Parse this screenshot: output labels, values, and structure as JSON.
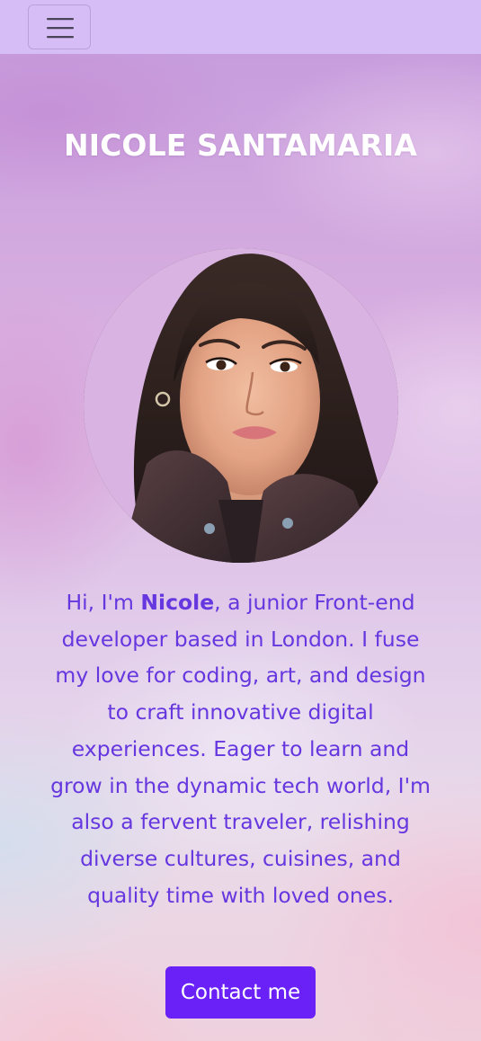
{
  "navbar": {
    "toggle_icon": "hamburger-menu-icon",
    "background_color": "#d7bdf5"
  },
  "hero": {
    "title": "NICOLE SANTAMARIA",
    "portrait_subject": "profile-photo",
    "bio": {
      "intro": "Hi, I'm ",
      "name": "Nicole",
      "rest": ", a junior Front-end developer based in London. I fuse my love for coding, art, and design to craft innovative digital experiences. Eager to learn and grow in the dynamic tech world, I'm also a fervent traveler, relishing diverse cultures, cuisines, and quality time with loved ones."
    },
    "contact_label": "Contact me"
  },
  "colors": {
    "accent": "#6a21f8",
    "bio_text": "#6637df",
    "title_text": "#ffffff"
  }
}
